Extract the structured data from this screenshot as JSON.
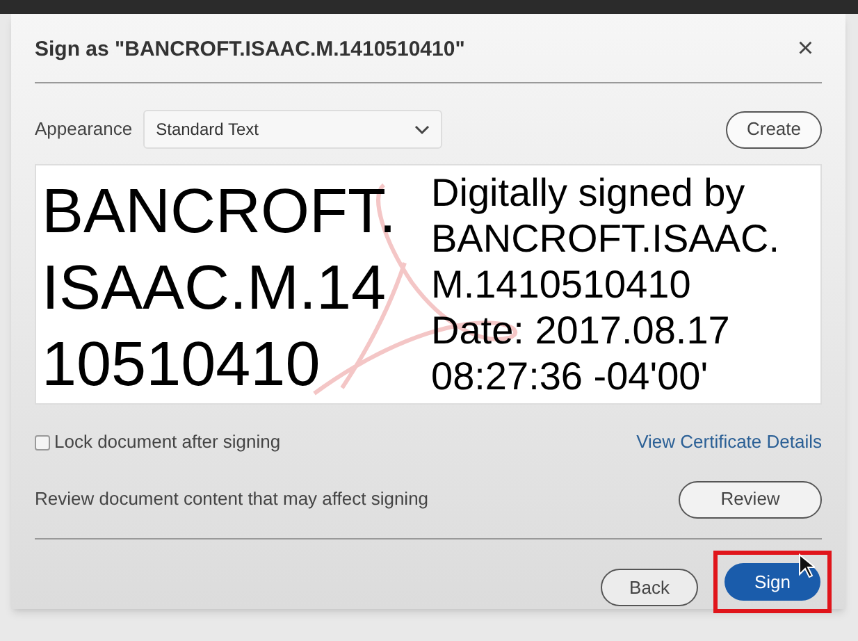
{
  "dialog": {
    "title": "Sign as \"BANCROFT.ISAAC.M.1410510410\"",
    "close": "×"
  },
  "appearance": {
    "label": "Appearance",
    "value": "Standard Text",
    "create_button": "Create"
  },
  "preview": {
    "name_lines": [
      "BANCROFT.",
      "ISAAC.M.14",
      "10510410"
    ],
    "detail_lines": [
      "Digitally signed by",
      "BANCROFT.ISAAC.",
      "M.1410510410",
      "Date: 2017.08.17",
      "08:27:36 -04'00'"
    ]
  },
  "lock": {
    "label": "Lock document after signing",
    "checked": false
  },
  "certificate_link": "View Certificate Details",
  "review": {
    "text": "Review document content that may affect signing",
    "button": "Review"
  },
  "buttons": [
    {
      "label": "Back",
      "kind": "secondary",
      "highlighted": false
    },
    {
      "label": "Sign",
      "kind": "primary",
      "highlighted": true
    }
  ]
}
